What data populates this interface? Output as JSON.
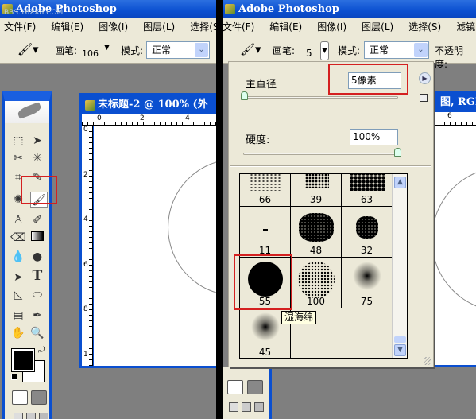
{
  "left": {
    "app_title": "Adobe Photoshop",
    "watermark": "BBS.16XX8.COM",
    "menu": [
      "文件(F)",
      "编辑(E)",
      "图像(I)",
      "图层(L)",
      "选择(S)"
    ],
    "options": {
      "brush_label": "画笔:",
      "brush_size": "106",
      "mode_label": "模式:",
      "mode_value": "正常"
    },
    "document": {
      "title": "未标题-2 @ 100% (外",
      "ruler_top": [
        "0",
        "2",
        "4"
      ],
      "ruler_left": [
        "0",
        "2",
        "4",
        "6",
        "8",
        "1"
      ]
    }
  },
  "right": {
    "app_title": "Adobe Photoshop",
    "menu": [
      "文件(F)",
      "编辑(E)",
      "图像(I)",
      "图层(L)",
      "选择(S)",
      "滤镜(T)"
    ],
    "options": {
      "brush_label": "画笔:",
      "brush_size": "5",
      "mode_label": "模式:",
      "mode_value": "正常",
      "opacity_label": "不透明度:"
    },
    "document": {
      "title": "图, RGB/",
      "ruler_top": [
        "6"
      ]
    },
    "brush_popup": {
      "master_diameter_label": "主直径",
      "master_diameter_value": "5像素",
      "master_diameter_fraction": 0.01,
      "hardness_label": "硬度:",
      "hardness_value": "100%",
      "hardness_fraction": 1.0,
      "brushes": [
        "66",
        "39",
        "63",
        "11",
        "48",
        "32",
        "55",
        "100",
        "75",
        "45"
      ],
      "selected_brush": "55",
      "tooltip": "湿海绵"
    }
  },
  "colors": {
    "title_bar": "#0a4fd0",
    "highlight": "#d42020",
    "panel": "#ece9d8",
    "workspace": "#7f7f7f"
  }
}
